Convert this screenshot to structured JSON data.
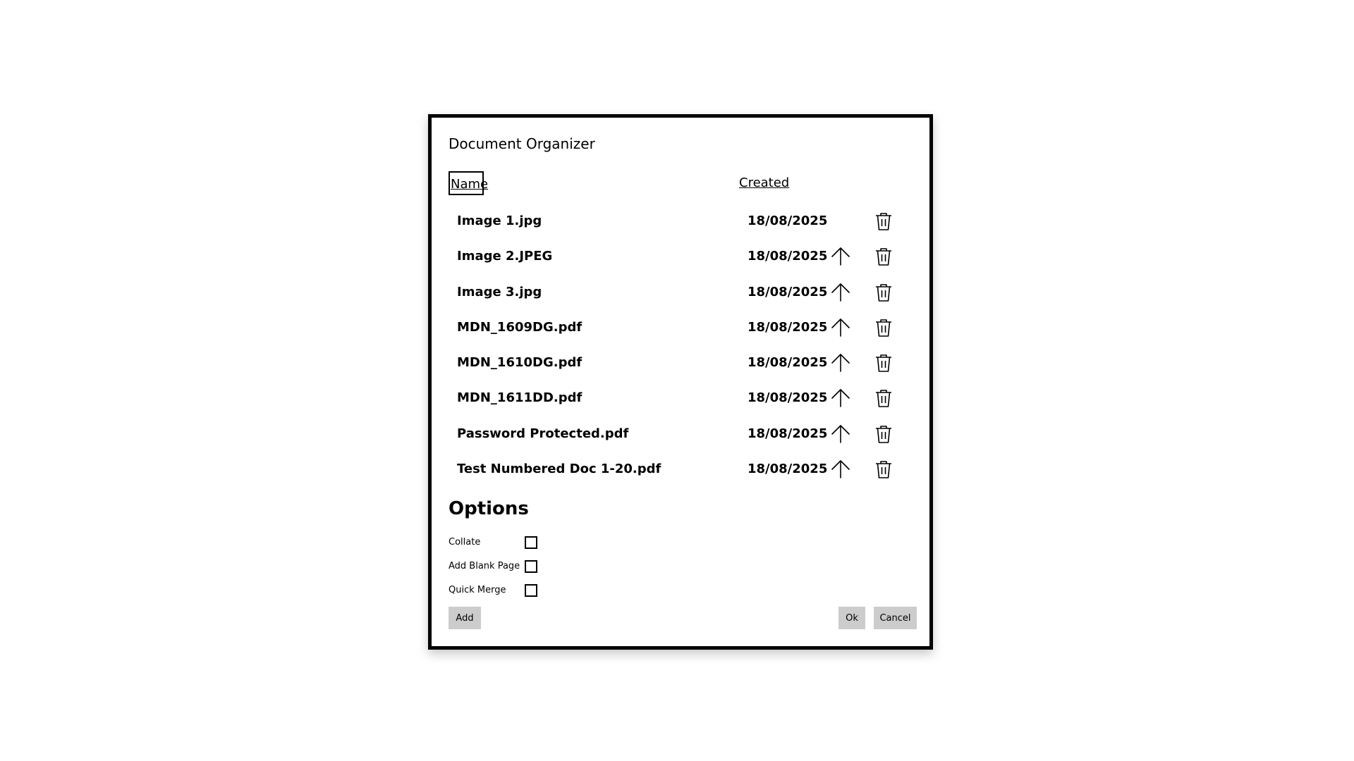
{
  "dialog": {
    "title": "Document Organizer"
  },
  "columns": {
    "name": "Name",
    "created": "Created"
  },
  "files": [
    {
      "name": "Image 1.jpg",
      "created": "18/08/2025",
      "can_move_up": false
    },
    {
      "name": "Image 2.JPEG",
      "created": "18/08/2025",
      "can_move_up": true
    },
    {
      "name": "Image 3.jpg",
      "created": "18/08/2025",
      "can_move_up": true
    },
    {
      "name": "MDN_1609DG.pdf",
      "created": "18/08/2025",
      "can_move_up": true
    },
    {
      "name": "MDN_1610DG.pdf",
      "created": "18/08/2025",
      "can_move_up": true
    },
    {
      "name": "MDN_1611DD.pdf",
      "created": "18/08/2025",
      "can_move_up": true
    },
    {
      "name": "Password Protected.pdf",
      "created": "18/08/2025",
      "can_move_up": true
    },
    {
      "name": "Test Numbered Doc 1-20.pdf",
      "created": "18/08/2025",
      "can_move_up": true
    }
  ],
  "icons": {
    "move_up": "arrow-up-icon",
    "delete": "trash-icon"
  },
  "options": {
    "title": "Options",
    "items": [
      {
        "label": "Collate",
        "checked": false
      },
      {
        "label": "Add Blank Page",
        "checked": false
      },
      {
        "label": "Quick Merge",
        "checked": false
      }
    ]
  },
  "buttons": {
    "add": "Add",
    "ok": "Ok",
    "cancel": "Cancel"
  },
  "colors": {
    "button_bg": "#cccccc",
    "border": "#000000",
    "background": "#ffffff"
  }
}
